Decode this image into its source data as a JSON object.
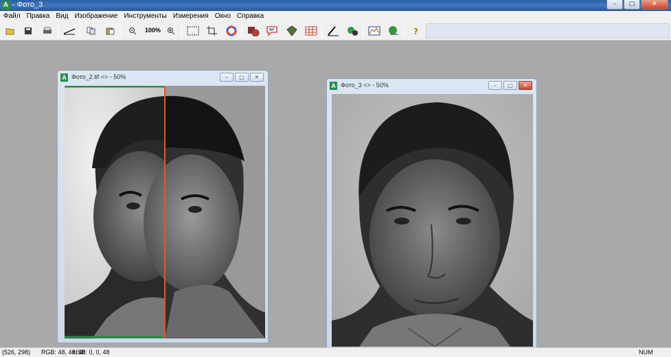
{
  "app": {
    "title": "- Фото_3",
    "icon_letter": "A"
  },
  "window_controls": {
    "minimize": "–",
    "maximize": "□",
    "close": "✕"
  },
  "menu": [
    {
      "label": "Файл"
    },
    {
      "label": "Правка"
    },
    {
      "label": "Вид"
    },
    {
      "label": "Изображение"
    },
    {
      "label": "Инструменты"
    },
    {
      "label": "Измерения"
    },
    {
      "label": "Окно"
    },
    {
      "label": "Справка"
    }
  ],
  "toolbar": {
    "zoom_label": "100%",
    "icons": [
      "open-icon",
      "save-icon",
      "print-icon",
      "measure-line-icon",
      "copy-icon",
      "paste-icon",
      "zoom-out-icon",
      "zoom-in-icon",
      "rect-select-icon",
      "crop-icon",
      "color-wheel-icon",
      "layers-icon",
      "annotation-icon",
      "stack-icon",
      "grid-icon",
      "marker-icon",
      "gear-cluster-icon",
      "histogram-icon",
      "palette-icon",
      "help-icon"
    ]
  },
  "child_windows": [
    {
      "title": "Фото_2.tif <> - 50%",
      "active": false
    },
    {
      "title": "Фото_3 <> - 50%",
      "active": true
    }
  ],
  "statusbar": {
    "coords": "(526, 298)",
    "rgb": "RGB: 48, 48, 48",
    "hsb": "HSB: 0, 0, 48",
    "num": "NUM"
  },
  "colors": {
    "titlebar": "#3f78c2",
    "workspace": "#a9a9a9",
    "split_line": "#e05a20",
    "accent_green": "#2a8d4a"
  }
}
